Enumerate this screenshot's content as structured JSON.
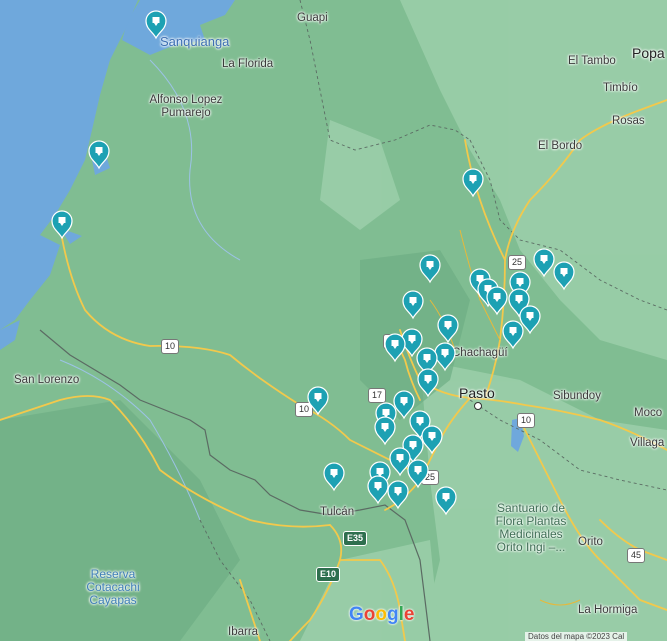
{
  "map": {
    "colors": {
      "water": "#6fa8dc",
      "land": "#80bd92",
      "land_light": "#9ccfaa",
      "road": "#f2c94c",
      "border": "#5b6b63",
      "marker": "#1da1b3"
    },
    "labels": {
      "guapi": "Guapi",
      "sanquianga": "Sanquianga",
      "la_florida": "La Florida",
      "alfonso_lopez_1": "Alfonso Lopez",
      "alfonso_lopez_2": "Pumarejo",
      "el_tambo": "El Tambo",
      "popa": "Popa",
      "timbio": "Timbío",
      "rosas": "Rosas",
      "el_bordo": "El Bordo",
      "san_lorenzo": "San Lorenzo",
      "chachagui": "Chachagüí",
      "pasto": "Pasto",
      "sibundoy": "Sibundoy",
      "mocoa": "Moco",
      "villagarzon": "Villaga",
      "tulcan": "Tulcán",
      "santuario_1": "Santuario de",
      "santuario_2": "Flora Plantas",
      "santuario_3": "Medicinales",
      "santuario_4": "Orito Ingi –...",
      "orito": "Orito",
      "la_hormiga": "La Hormiga",
      "reserva_1": "Reserva",
      "reserva_2": "Cotacachi",
      "reserva_3": "Cayapas",
      "ibarra": "Ibarra"
    },
    "shields": {
      "r10_west": "10",
      "r10_mid": "10",
      "r10_east": "10",
      "r17_a": "17",
      "r17_b": "17",
      "r25_north": "25",
      "r25_south": "25",
      "r45": "45",
      "e35": "E35",
      "e10": "E10"
    },
    "attribution": {
      "google": "Google",
      "copyright": "Datos del mapa ©2023   Cal"
    }
  }
}
